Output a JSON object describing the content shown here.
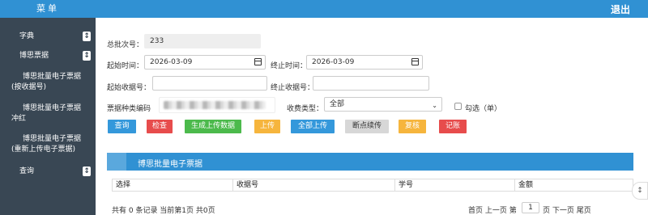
{
  "sidebar": {
    "title": "菜单",
    "items": [
      {
        "label": "字典",
        "toggle": "↕"
      },
      {
        "label": "博思票据",
        "toggle": "↕"
      },
      {
        "label": "博思批量电子票据(按收据号)"
      },
      {
        "label": "博思批量电子票据冲红"
      },
      {
        "label": "博思批量电子票据(重新上传电子票据)"
      },
      {
        "label": "查询",
        "toggle": "↕"
      }
    ]
  },
  "header": {
    "logout": "退出"
  },
  "form": {
    "batch_label": "总批次号：",
    "batch_value": "233",
    "start_time_label": "起始时间：",
    "start_time_value": "2026-03-09",
    "end_time_label": "终止时间：",
    "end_time_value": "2026-03-09",
    "start_receipt_label": "起始收据号：",
    "end_receipt_label": "终止收据号：",
    "type_code_label": "票据种类编码",
    "fee_type_label": "收费类型：",
    "fee_type_value": "全部",
    "check_label": "勾选（单）"
  },
  "buttons": [
    {
      "label": "查询",
      "color": "#3498db"
    },
    {
      "label": "检查",
      "color": "#e74c4c"
    },
    {
      "label": "生成上传数据",
      "color": "#4cba4c"
    },
    {
      "label": "上传",
      "color": "#f6b53d"
    },
    {
      "label": "全部上传",
      "color": "#3498db"
    },
    {
      "label": "断点续传",
      "color": "#d7d7d7"
    },
    {
      "label": "复核",
      "color": "#f6b53d"
    },
    {
      "label": "记账",
      "color": "#e74c4c"
    }
  ],
  "panel": {
    "title": "博思批量电子票据"
  },
  "table": {
    "columns": [
      "选择",
      "收据号",
      "学号",
      "金额"
    ]
  },
  "footer": {
    "summary": "共有 0 条记录 当前第1页 共0页",
    "nav_prefix": "首页 上一页 第",
    "page_value": "1",
    "nav_suffix": "页 下一页 尾页"
  },
  "float_button": {
    "icon": "expand-icon",
    "label": "↕"
  }
}
